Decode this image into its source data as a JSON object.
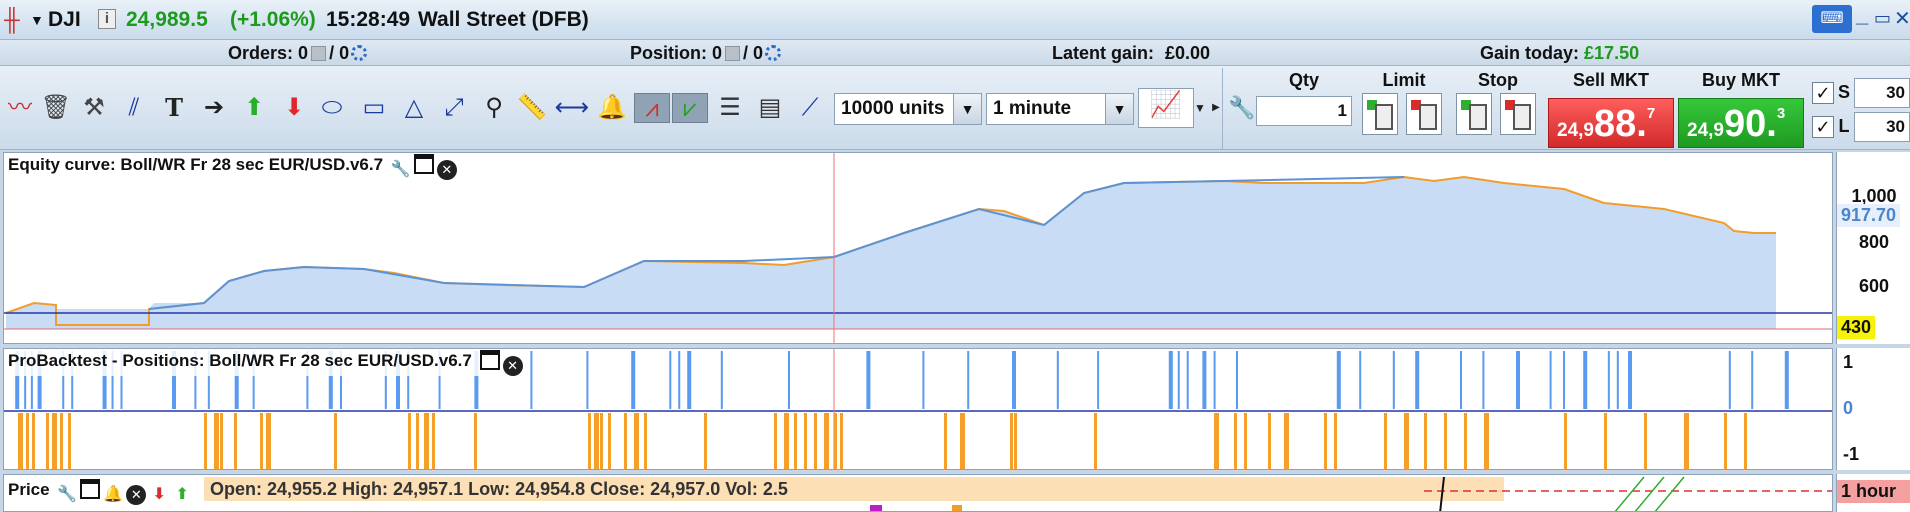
{
  "titlebar": {
    "symbol": "DJI",
    "info_icon": "i",
    "price": "24,989.5",
    "change": "(+1.06%)",
    "time": "15:28:49",
    "market": "Wall Street (DFB)",
    "colors": {
      "change": "#1e9a1e"
    }
  },
  "ordersbar": {
    "orders_label": "Orders:",
    "orders_value": "0",
    "orders_total": "/ 0",
    "position_label": "Position:",
    "position_value": "0",
    "position_total": "/ 0",
    "latent_label": "Latent gain:",
    "latent_value": "£0.00",
    "gain_label": "Gain today:",
    "gain_value": "£17.50"
  },
  "toolbar": {
    "tools": [
      "line-tool-icon",
      "trash-icon",
      "tools-icon",
      "parallel-lines-icon",
      "text-tool-icon",
      "arrow-right-icon",
      "arrow-up-green-icon",
      "arrow-down-red-icon",
      "ellipse-icon",
      "rectangle-icon",
      "triangle-icon",
      "diagonal-line-icon",
      "magnifier-icon",
      "ruler-icon",
      "horizontal-line-icon",
      "alert-bell-icon",
      "zigzag-indicator-icon",
      "zigzag-green-icon",
      "fibonacci-icon",
      "fan-icon",
      "trendline-icon"
    ],
    "units_select": "10000 units",
    "timeframe_select": "1 minute"
  },
  "order_panel": {
    "qty_label": "Qty",
    "qty_value": "1",
    "limit_label": "Limit",
    "stop_label": "Stop",
    "sell_label": "Sell MKT",
    "sell_small": "24,9",
    "sell_big": "88.",
    "sell_sup": "7",
    "buy_label": "Buy MKT",
    "buy_small": "24,9",
    "buy_big": "90.",
    "buy_sup": "3",
    "s_label": "S",
    "s_value": "30",
    "l_label": "L",
    "l_value": "30"
  },
  "equity_panel": {
    "title": "Equity curve: Boll/WR Fr 28 sec EUR/USD.v6.7",
    "ticks": [
      "1,000",
      "800",
      "600"
    ],
    "current_tag": "917.70",
    "base_tag": "430"
  },
  "positions_panel": {
    "title": "ProBacktest - Positions: Boll/WR Fr 28 sec EUR/USD.v6.7",
    "ticks": [
      "1",
      "0",
      "-1"
    ]
  },
  "price_panel": {
    "title": "Price",
    "overlay_text": "Open: 24,955.2  High: 24,957.1  Low: 24,954.8  Close: 24,957.0  Vol: 2.5",
    "timeframe_tag": "1 hour"
  },
  "colors": {
    "equity_line": "#5b93d6",
    "equity_fill": "#c8dcf6",
    "equity_step": "#f29c29",
    "long_bar": "#5a9af0",
    "short_bar": "#f5a02a",
    "sell": "#d93030",
    "buy": "#24a928"
  }
}
